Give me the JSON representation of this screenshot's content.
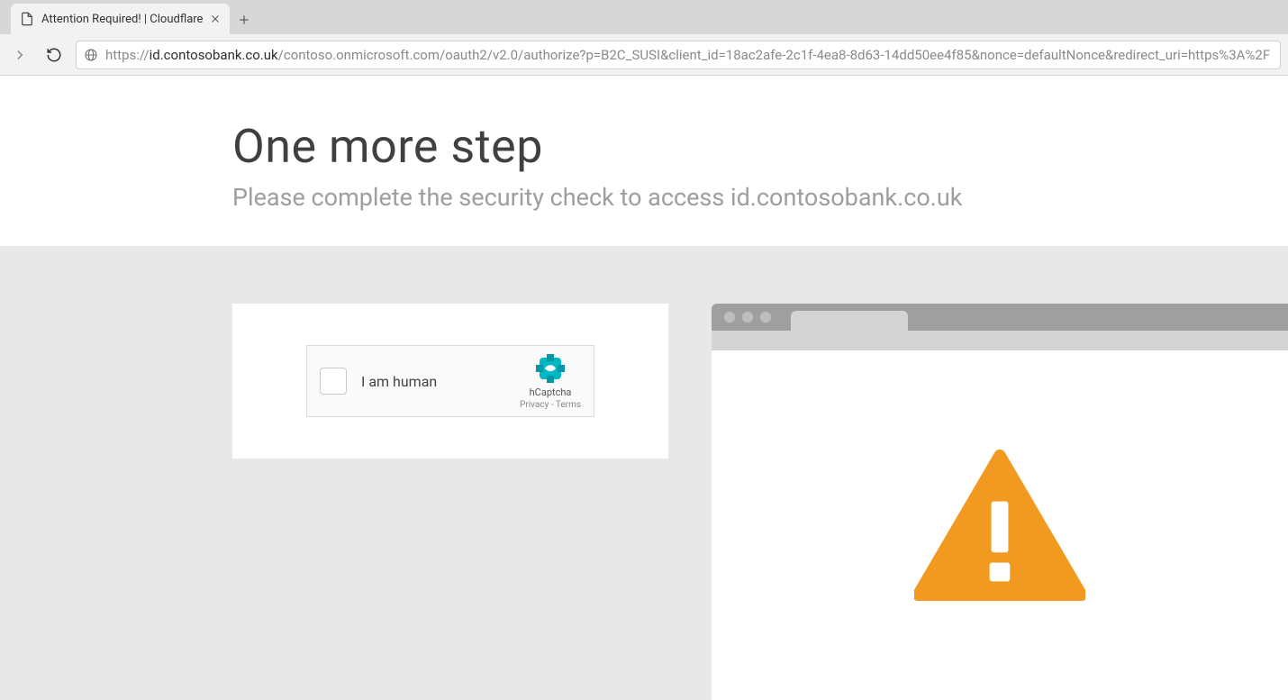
{
  "browser": {
    "tab_title": "Attention Required! | Cloudflare",
    "url_scheme": "https://",
    "url_host": "id.contosobank.co.uk",
    "url_path": "/contoso.onmicrosoft.com/oauth2/v2.0/authorize?p=B2C_SUSI&client_id=18ac2afe-2c1f-4ea8-8d63-14dd50ee4f85&nonce=defaultNonce&redirect_uri=https%3A%2F"
  },
  "page": {
    "heading": "One more step",
    "subtitle": "Please complete the security check to access id.contosobank.co.uk"
  },
  "captcha": {
    "label": "I am human",
    "brand": "hCaptcha",
    "privacy": "Privacy",
    "sep": " - ",
    "terms": "Terms"
  }
}
